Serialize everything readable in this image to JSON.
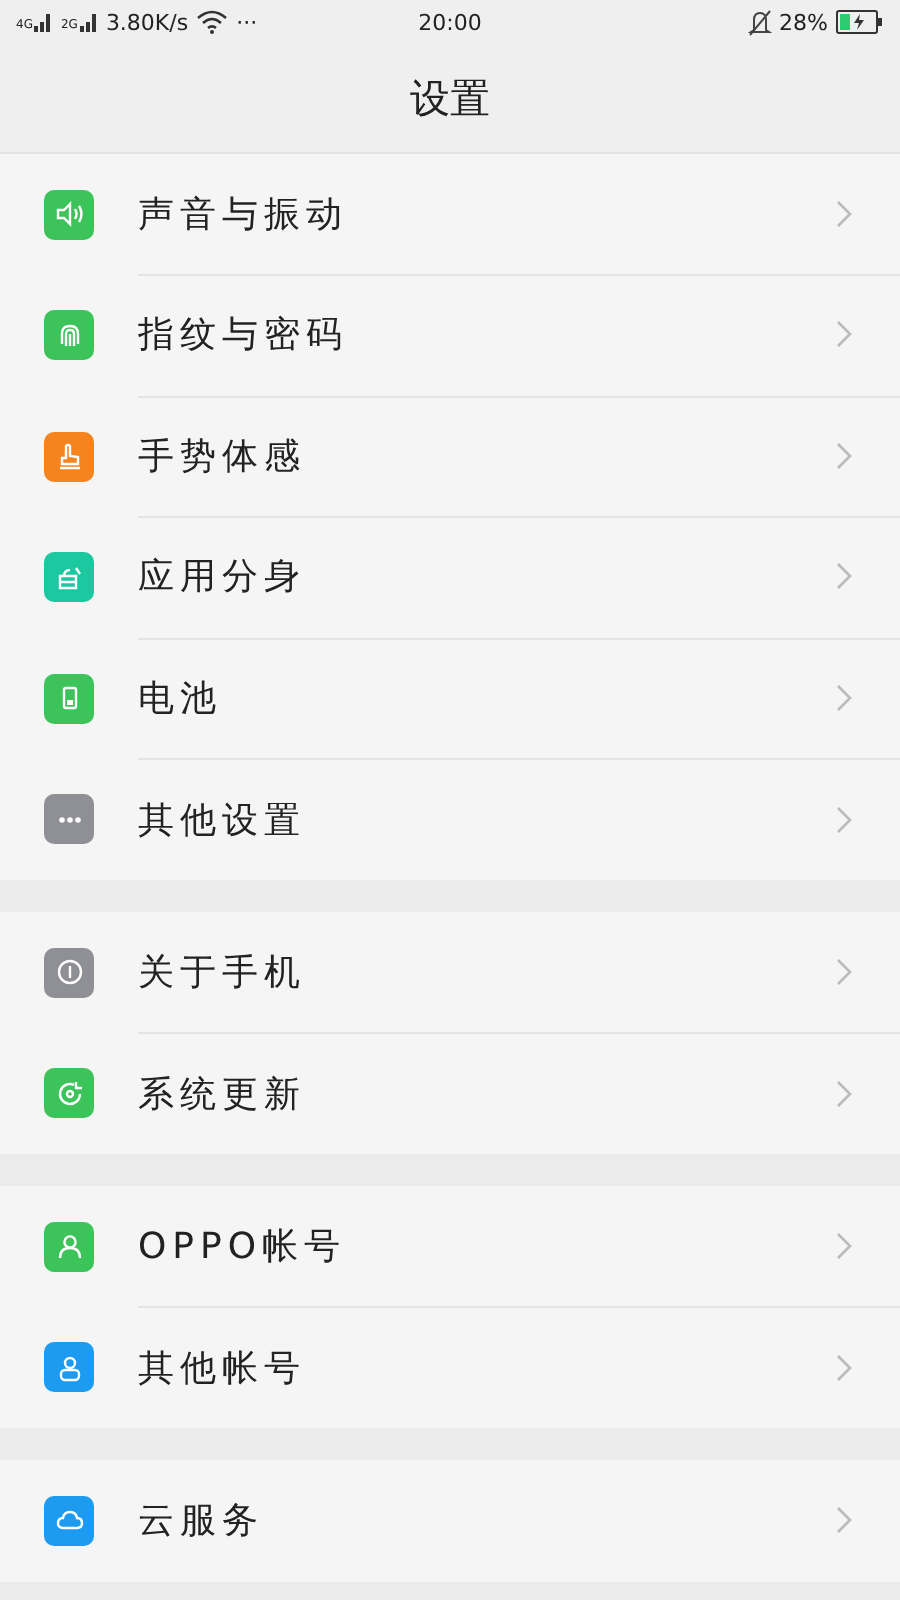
{
  "status_bar": {
    "network_1": "4G",
    "network_2": "2G",
    "speed": "3.80K/s",
    "more": "···",
    "time": "20:00",
    "battery_percent": "28%"
  },
  "title": "设置",
  "groups": [
    {
      "items": [
        {
          "label": "声音与振动",
          "kind": "sound",
          "color": "#3cc35a"
        },
        {
          "label": "指纹与密码",
          "kind": "fingerprint",
          "color": "#3cc35a"
        },
        {
          "label": "手势体感",
          "kind": "gesture",
          "color": "#f5841f"
        },
        {
          "label": "应用分身",
          "kind": "clone",
          "color": "#1cc8a0"
        },
        {
          "label": "电池",
          "kind": "battery",
          "color": "#3cc35a"
        },
        {
          "label": "其他设置",
          "kind": "more",
          "color": "#8e9096"
        }
      ]
    },
    {
      "items": [
        {
          "label": "关于手机",
          "kind": "info",
          "color": "#8e9096"
        },
        {
          "label": "系统更新",
          "kind": "update",
          "color": "#3cc35a"
        }
      ]
    },
    {
      "items": [
        {
          "label": "OPPO帐号",
          "kind": "account",
          "color": "#3cc35a"
        },
        {
          "label": "其他帐号",
          "kind": "person",
          "color": "#1d9bf0"
        }
      ]
    },
    {
      "items": [
        {
          "label": "云服务",
          "kind": "cloud",
          "color": "#1d9bf0"
        }
      ]
    }
  ]
}
